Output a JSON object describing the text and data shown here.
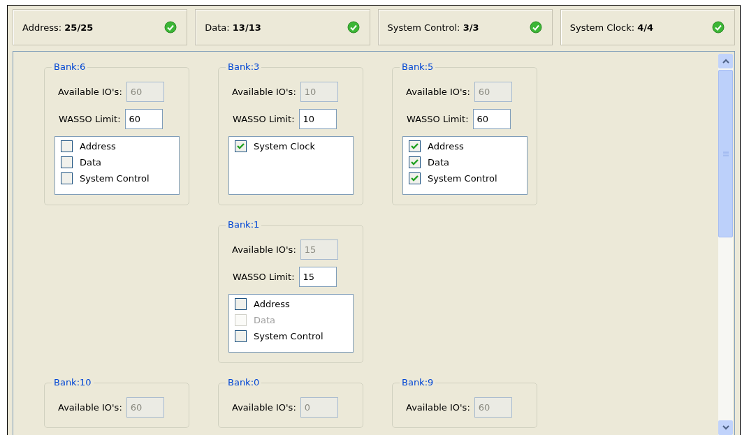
{
  "status_panels": [
    {
      "text": "Address: **25/25**",
      "ok": true
    },
    {
      "text": "Data: **13/13**",
      "ok": true
    },
    {
      "text": "System Control: **3/3**",
      "ok": true
    },
    {
      "text": "System Clock: **4/4**",
      "ok": true
    }
  ],
  "bank_rows": [
    [
      {
        "title": "Bank:6",
        "available_label": "Available IO's:",
        "available": "60",
        "wasso_label": "WASSO Limit:",
        "wasso": "60",
        "items": [
          {
            "label": "Address",
            "checked": false,
            "disabled": false
          },
          {
            "label": "Data",
            "checked": false,
            "disabled": false
          },
          {
            "label": "System Control",
            "checked": false,
            "disabled": false
          }
        ]
      },
      {
        "title": "Bank:3",
        "available_label": "Available IO's:",
        "available": "10",
        "wasso_label": "WASSO Limit:",
        "wasso": "10",
        "items": [
          {
            "label": "System Clock",
            "checked": true,
            "disabled": false
          }
        ]
      },
      {
        "title": "Bank:5",
        "available_label": "Available IO's:",
        "available": "60",
        "wasso_label": "WASSO Limit:",
        "wasso": "60",
        "items": [
          {
            "label": "Address",
            "checked": true,
            "disabled": false
          },
          {
            "label": "Data",
            "checked": true,
            "disabled": false
          },
          {
            "label": "System Control",
            "checked": true,
            "disabled": false
          }
        ]
      }
    ],
    [
      null,
      {
        "title": "Bank:1",
        "available_label": "Available IO's:",
        "available": "15",
        "wasso_label": "WASSO Limit:",
        "wasso": "15",
        "items": [
          {
            "label": "Address",
            "checked": false,
            "disabled": false
          },
          {
            "label": "Data",
            "checked": false,
            "disabled": true
          },
          {
            "label": "System Control",
            "checked": false,
            "disabled": false
          }
        ]
      },
      null
    ],
    [
      {
        "title": "Bank:10",
        "available_label": "Available IO's:",
        "available": "60"
      },
      {
        "title": "Bank:0",
        "available_label": "Available IO's:",
        "available": "0"
      },
      {
        "title": "Bank:9",
        "available_label": "Available IO's:",
        "available": "60"
      }
    ]
  ]
}
